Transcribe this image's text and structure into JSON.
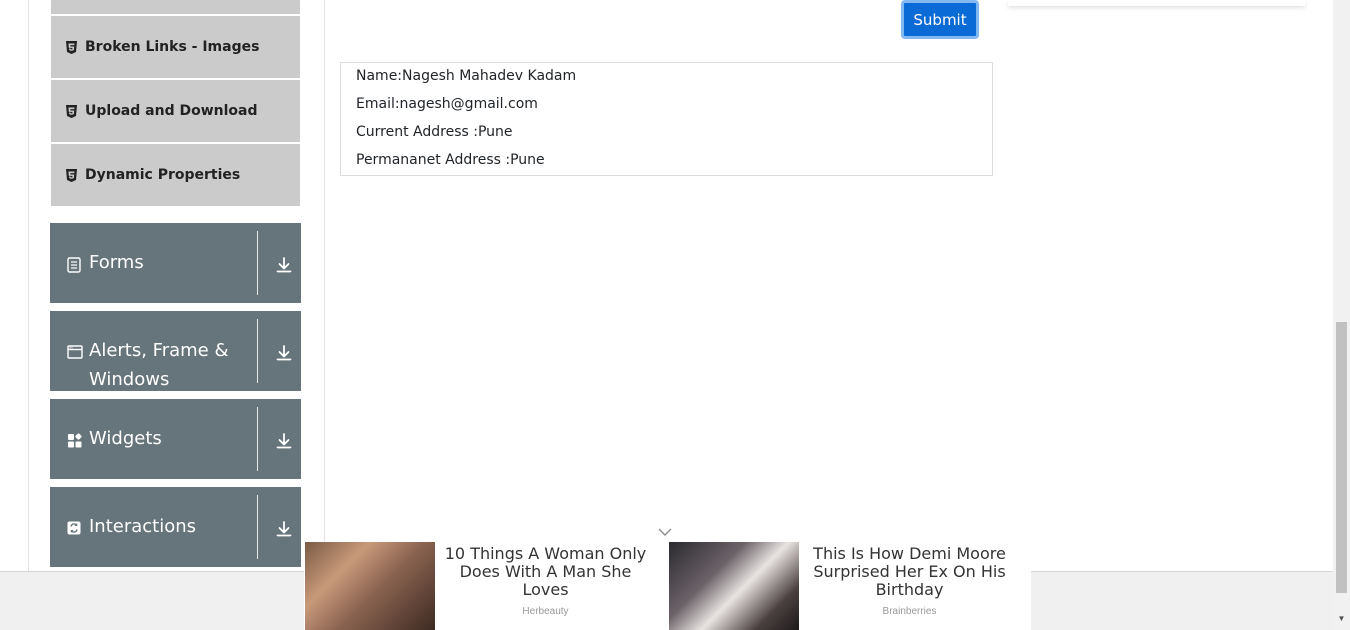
{
  "sidebar": {
    "sub_items": [
      {
        "label": "Broken Links - Images",
        "icon": "html5-icon"
      },
      {
        "label": "Upload and Download",
        "icon": "html5-icon"
      },
      {
        "label": "Dynamic Properties",
        "icon": "html5-icon"
      }
    ],
    "groups": [
      {
        "label": "Forms",
        "icon": "form-icon"
      },
      {
        "label": "Alerts, Frame & Windows",
        "icon": "window-icon"
      },
      {
        "label": "Widgets",
        "icon": "widgets-icon"
      },
      {
        "label": "Interactions",
        "icon": "interactions-icon"
      }
    ],
    "colors": {
      "sub_bg": "#cbcbcb",
      "group_bg": "#66747b"
    }
  },
  "form": {
    "submit_label": "Submit"
  },
  "output": {
    "name": "Name:Nagesh Mahadev Kadam",
    "email": "Email:nagesh@gmail.com",
    "current_address": "Current Address :Pune",
    "permanent_address": "Permananet Address :Pune"
  },
  "ads": [
    {
      "title": "10 Things A Woman Only Does With A Man She Loves",
      "source": "Herbeauty"
    },
    {
      "title": "This Is How Demi Moore Surprised Her Ex On His Birthday",
      "source": "Brainberries"
    }
  ],
  "accent_color": "#0a6ad6"
}
